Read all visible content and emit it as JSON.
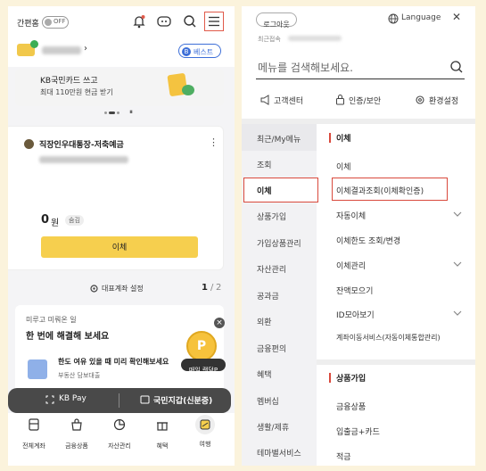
{
  "left": {
    "simple_login_label": "간편홈",
    "toggle_label": "OFF",
    "best_label": "베스트",
    "best_badge": "B",
    "promo": {
      "title": "KB국민카드 쓰고",
      "subtitle": "최대 110만원 현금 받기"
    },
    "account": {
      "name": "직장인우대통장-저축예금",
      "balance": "0",
      "currency": "원",
      "hide_label": "숨김",
      "transfer_button": "이체",
      "more": "⋮"
    },
    "main_account_setting": "대표계좌 설정",
    "page_current": "1",
    "page_sep": "/",
    "page_total": "2",
    "todo": {
      "small": "미루고 미뤄온 일",
      "title": "한 번에 해결해 보세요",
      "item_title": "한도 여유 있을 때 미리 확인해보세요",
      "item_sub": "부동산 담보대출",
      "close": "×"
    },
    "coin_letter": "P",
    "random_badge": "매일 랜덤P",
    "dark_bar": {
      "kbpay": "KB Pay",
      "wallet": "국민지갑(신분증)"
    },
    "bottom_nav": [
      {
        "label": "전체계좌",
        "icon": "document-icon"
      },
      {
        "label": "금융상품",
        "icon": "bag-icon"
      },
      {
        "label": "자산관리",
        "icon": "pie-chart-icon"
      },
      {
        "label": "혜택",
        "icon": "gift-icon"
      },
      {
        "label": "여행",
        "icon": "plane-icon"
      }
    ]
  },
  "right": {
    "logout": "로그아웃",
    "language": "Language",
    "close": "✕",
    "last_access_label": "최근접속",
    "search_placeholder": "메뉴를 검색해보세요.",
    "quick": {
      "support": "고객센터",
      "auth": "인증/보안",
      "settings": "환경설정"
    },
    "left_menu": [
      "최근/My메뉴",
      "조회",
      "이체",
      "상품가입",
      "가입상품관리",
      "자산관리",
      "공과금",
      "외환",
      "금융편의",
      "혜택",
      "멤버십",
      "생활/제휴",
      "테마별서비스"
    ],
    "section_transfer": "이체",
    "transfer_items": [
      "이체",
      "이체결과조회(이체확인증)",
      "자동이체",
      "이체한도 조회/변경",
      "이체관리",
      "잔액모으기",
      "ID모아보기",
      "계좌이동서비스(자동이체통합관리)"
    ],
    "section_product": "상품가입",
    "product_items": [
      "금융상품",
      "입출금+카드",
      "적금"
    ],
    "chevron": "⌄"
  },
  "colors": {
    "accent_red": "#d9493c",
    "kb_yellow": "#f6cf4e",
    "best_blue": "#3d6fd8"
  }
}
